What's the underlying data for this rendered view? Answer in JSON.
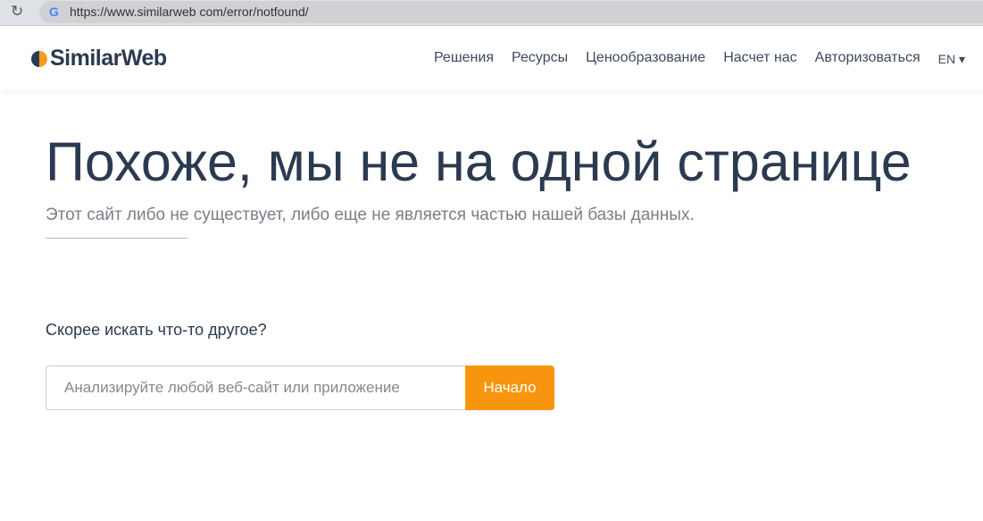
{
  "browser": {
    "url": "https://www.similarweb com/error/notfound/"
  },
  "nav": {
    "logo": "SimilarWeb",
    "items": [
      "Решения",
      "Ресурсы",
      "Ценообразование",
      "Насчет нас",
      "Авторизоваться"
    ],
    "lang": "EN ▾"
  },
  "main": {
    "title": "Похоже, мы не на одной странице",
    "subtitle": "Этот сайт либо не существует, либо еще не является частью нашей базы данных.",
    "prompt": "Скорее искать что-то другое?",
    "search_placeholder": "Анализируйте любой веб-сайт или приложение",
    "button": "Начало"
  },
  "colors": {
    "accent": "#f8950f",
    "text": "#2b3a4f"
  }
}
